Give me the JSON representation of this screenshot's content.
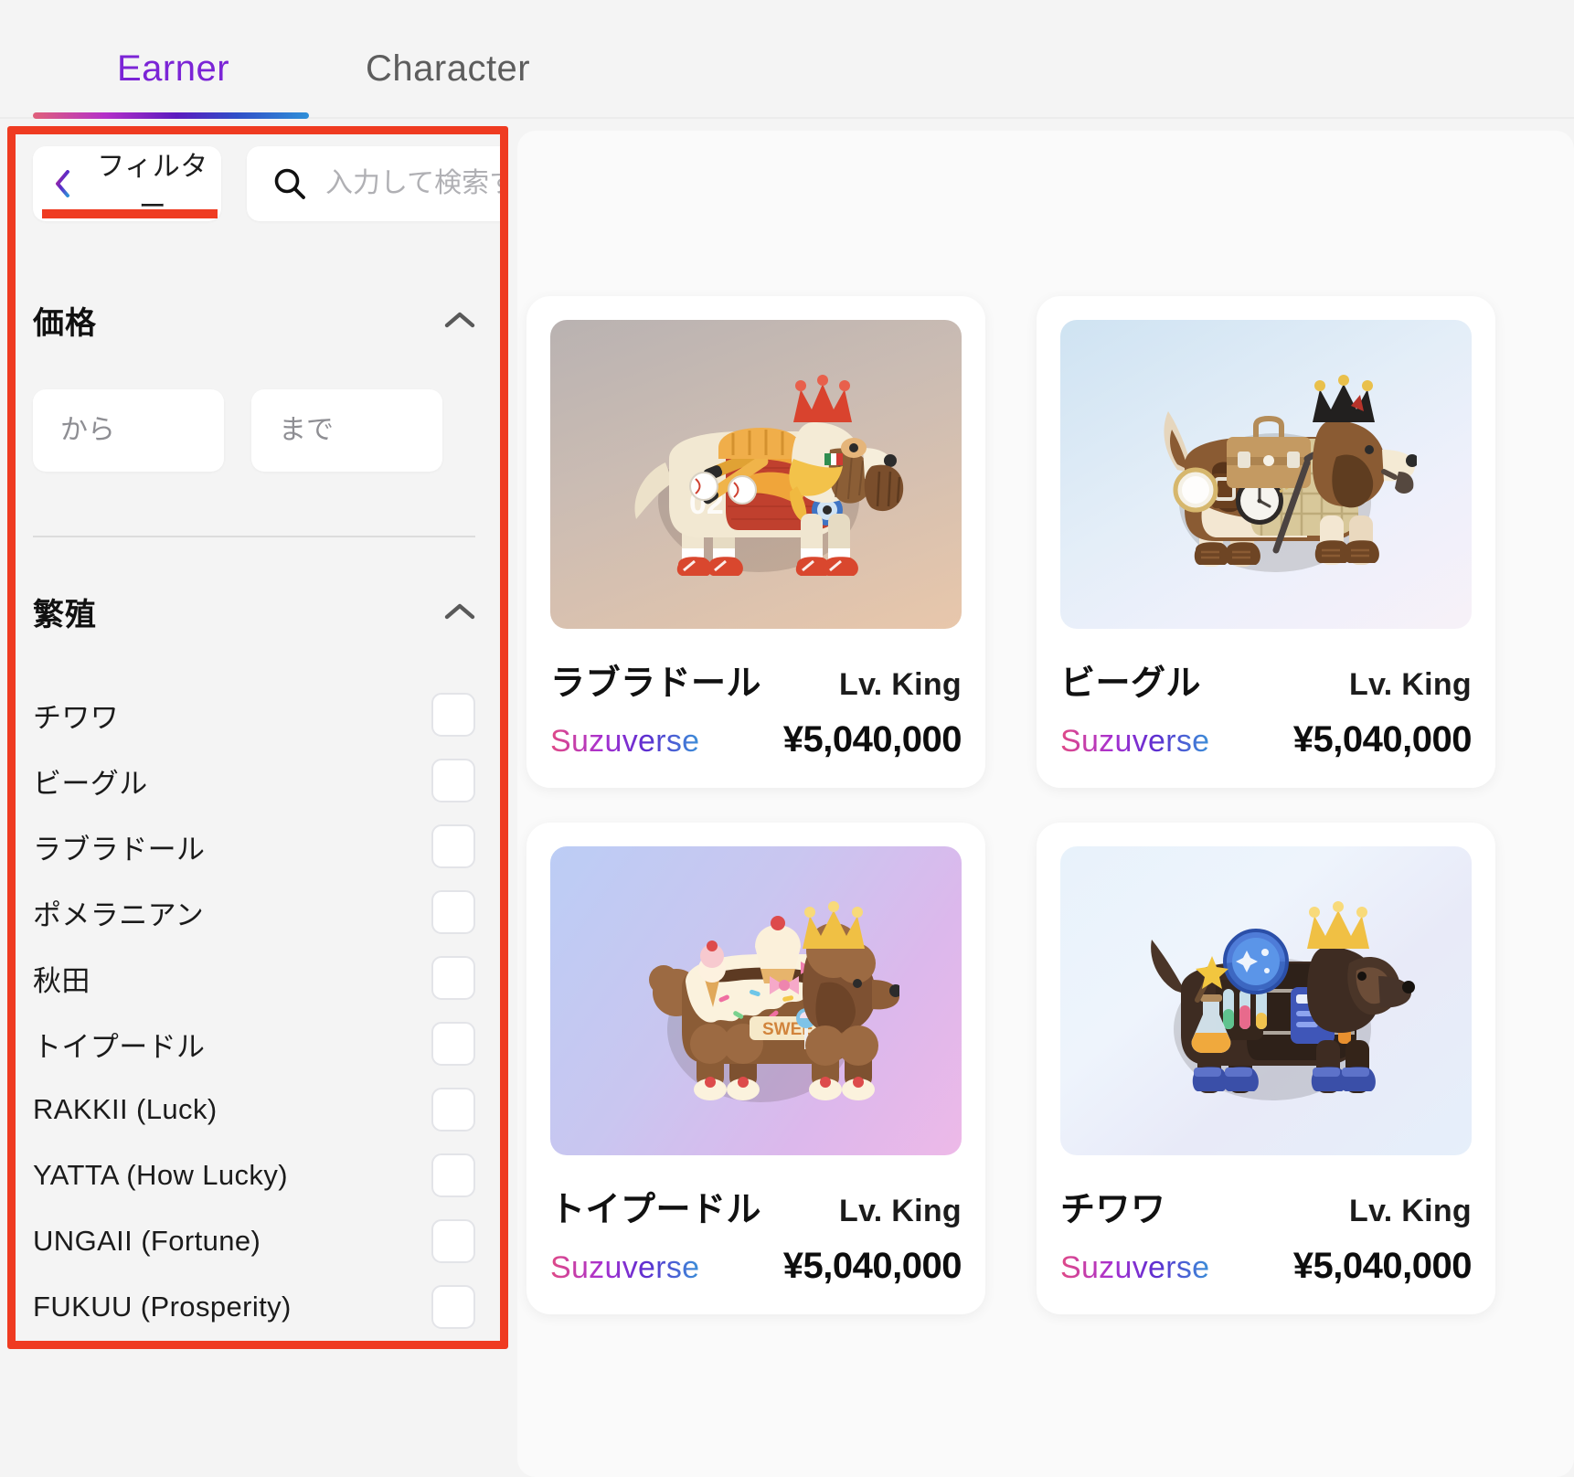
{
  "tabs": [
    {
      "label": "Earner",
      "active": true
    },
    {
      "label": "Character",
      "active": false
    }
  ],
  "filter_bar": {
    "filter_button_label": "フィルター",
    "back_icon": "chevron-left-icon",
    "search_icon": "search-icon",
    "search_placeholder": "入力して検索する",
    "search_value": ""
  },
  "sections": [
    {
      "id": "price",
      "title": "価格",
      "collapse_icon": "chevron-up-icon",
      "min_placeholder": "から",
      "max_placeholder": "まで",
      "min_value": "",
      "max_value": ""
    },
    {
      "id": "breed",
      "title": "繁殖",
      "collapse_icon": "chevron-up-icon"
    }
  ],
  "breeds": [
    {
      "label": "チワワ",
      "checked": false
    },
    {
      "label": "ビーグル",
      "checked": false
    },
    {
      "label": "ラブラドール",
      "checked": false
    },
    {
      "label": "ポメラニアン",
      "checked": false
    },
    {
      "label": "秋田",
      "checked": false
    },
    {
      "label": "トイプードル",
      "checked": false
    },
    {
      "label": "RAKKII (Luck)",
      "checked": false
    },
    {
      "label": "YATTA (How Lucky)",
      "checked": false
    },
    {
      "label": "UNGAII (Fortune)",
      "checked": false
    },
    {
      "label": "FUKUU (Prosperity)",
      "checked": false
    }
  ],
  "cards": [
    {
      "name": "ラブラドール",
      "level": "Lv. King",
      "brand": "Suzuverse",
      "price": "¥5,040,000",
      "theme": "baseball"
    },
    {
      "name": "ビーグル",
      "level": "Lv. King",
      "brand": "Suzuverse",
      "price": "¥5,040,000",
      "theme": "detective"
    },
    {
      "name": "トイプードル",
      "level": "Lv. King",
      "brand": "Suzuverse",
      "price": "¥5,040,000",
      "theme": "dessert"
    },
    {
      "name": "チワワ",
      "level": "Lv. King",
      "brand": "Suzuverse",
      "price": "¥5,040,000",
      "theme": "scientist"
    }
  ],
  "annotation": {
    "box_color": "#ef3b21",
    "underline_color": "#ef3b21"
  },
  "colors": {
    "page_background": "#f4f4f4",
    "card_background": "#ffffff",
    "active_tab": "#7b24d6",
    "inactive_tab": "#5d5d5d",
    "annotation_red": "#ef3b21"
  }
}
